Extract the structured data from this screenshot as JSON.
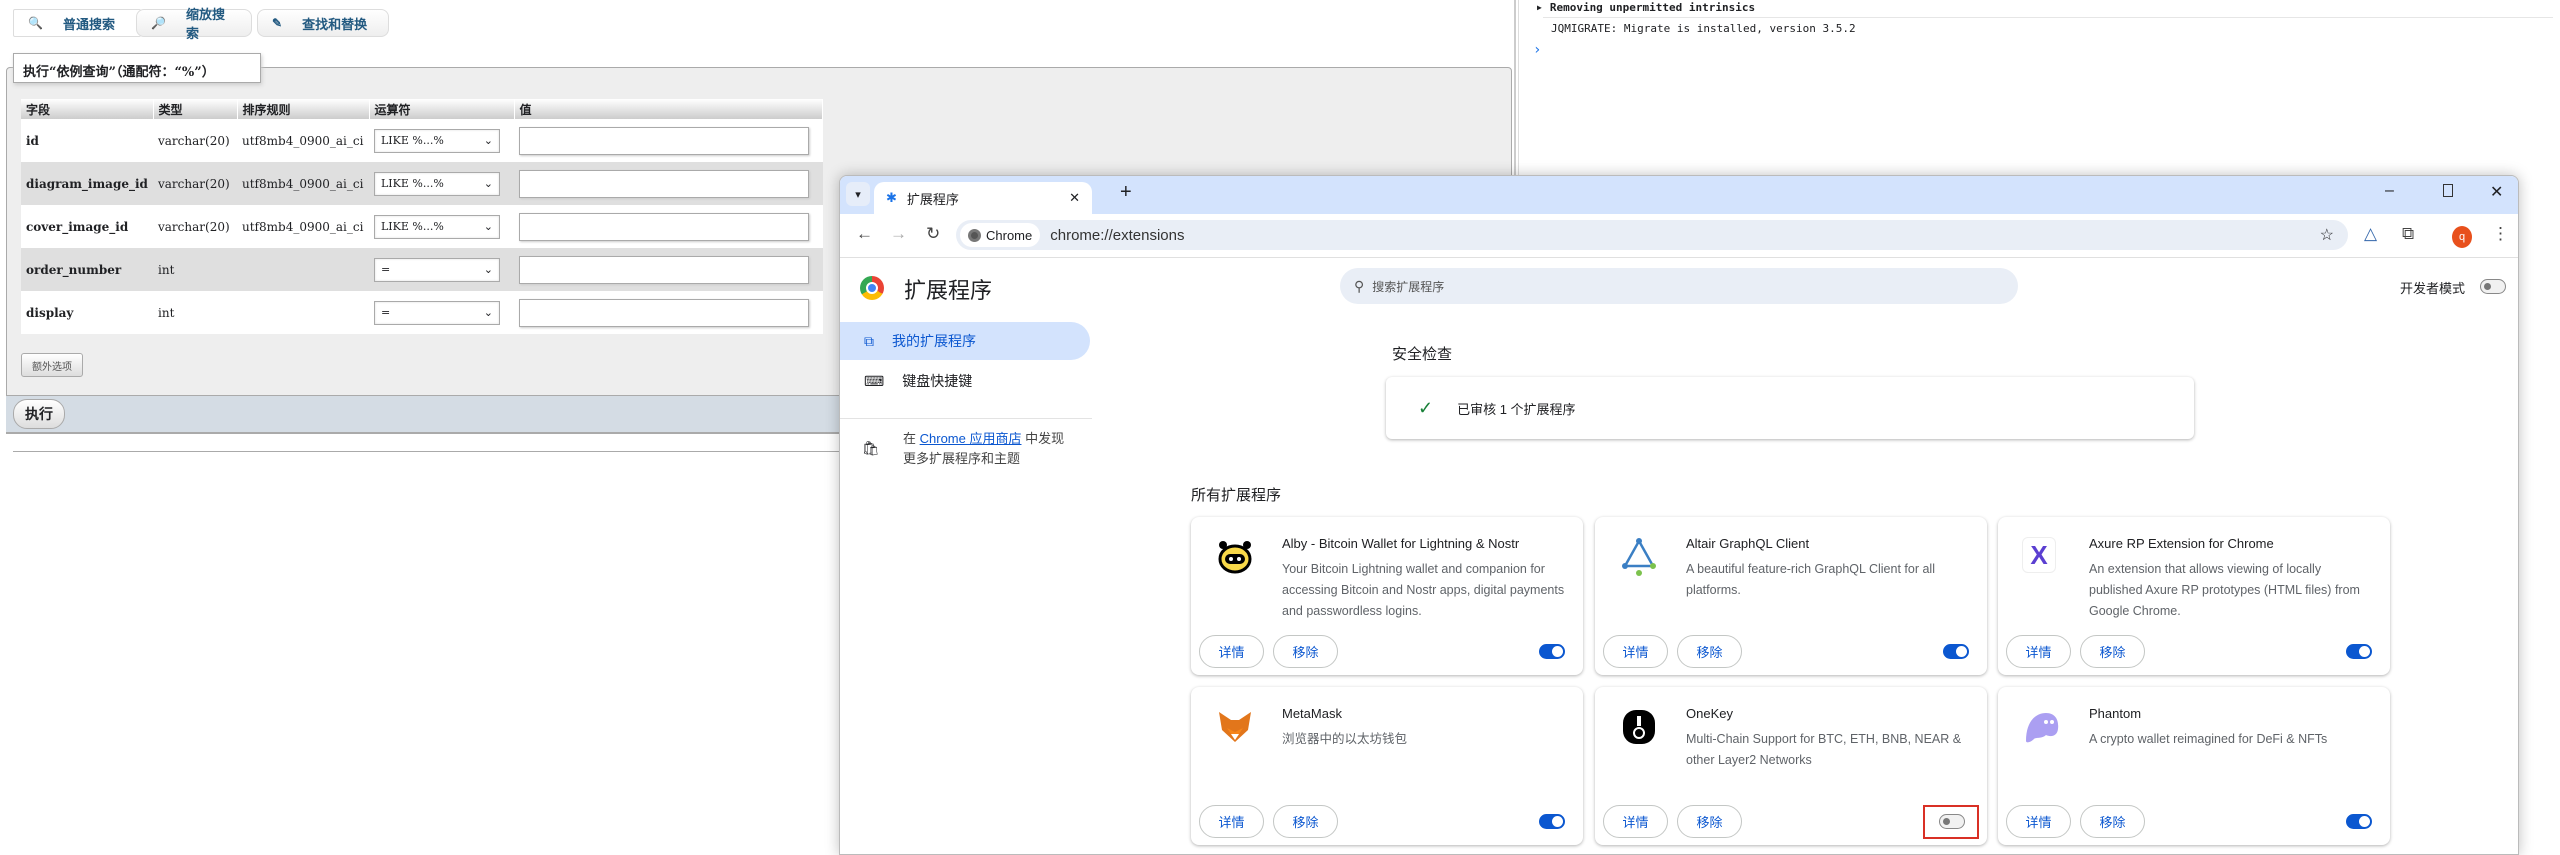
{
  "pma": {
    "tabs": [
      {
        "label": "普通搜索",
        "icon": "magnifier-icon"
      },
      {
        "label": "缩放搜索",
        "icon": "zoom-search-icon"
      },
      {
        "label": "查找和替换",
        "icon": "find-replace-icon"
      }
    ],
    "legend": "执行“依例查询”（通配符：“%”）",
    "headers": [
      "字段",
      "类型",
      "排序规则",
      "运算符",
      "值"
    ],
    "rows": [
      {
        "field": "id",
        "type": "varchar(20)",
        "collation": "utf8mb4_0900_ai_ci",
        "op": "LIKE %...%",
        "value": ""
      },
      {
        "field": "diagram_image_id",
        "type": "varchar(20)",
        "collation": "utf8mb4_0900_ai_ci",
        "op": "LIKE %...%",
        "value": ""
      },
      {
        "field": "cover_image_id",
        "type": "varchar(20)",
        "collation": "utf8mb4_0900_ai_ci",
        "op": "LIKE %...%",
        "value": ""
      },
      {
        "field": "order_number",
        "type": "int",
        "collation": "",
        "op": "=",
        "value": ""
      },
      {
        "field": "display",
        "type": "int",
        "collation": "",
        "op": "=",
        "value": ""
      }
    ],
    "extra_label": "额外选项",
    "exec_label": "执行"
  },
  "console": {
    "lines": [
      "Removing unpermitted intrinsics",
      "JQMIGRATE: Migrate is installed, version 3.5.2"
    ],
    "prompt": "›"
  },
  "chrome": {
    "tab_title": "扩展程序",
    "chip": "Chrome",
    "url": "chrome://extensions",
    "avatar": "q",
    "page_title": "扩展程序",
    "search_placeholder": "搜索扩展程序",
    "dev_mode": "开发者模式",
    "nav": [
      "我的扩展程序",
      "键盘快捷键"
    ],
    "store": {
      "pre": "在 ",
      "link": "Chrome 应用商店",
      "post": " 中发现",
      "line2": "更多扩展程序和主题"
    },
    "safety_title": "安全检查",
    "safety_text": "已审核 1 个扩展程序",
    "all_title": "所有扩展程序",
    "details": "详情",
    "remove": "移除",
    "extensions": [
      {
        "name": "Alby - Bitcoin Wallet for Lightning & Nostr",
        "desc": "Your Bitcoin Lightning wallet and companion for accessing Bitcoin and Nostr apps, digital payments and passwordless logins.",
        "enabled": true
      },
      {
        "name": "Altair GraphQL Client",
        "desc": "A beautiful feature-rich GraphQL Client for all platforms.",
        "enabled": true
      },
      {
        "name": "Axure RP Extension for Chrome",
        "desc": "An extension that allows viewing of locally published Axure RP prototypes (HTML files) from Google Chrome.",
        "enabled": true
      },
      {
        "name": "MetaMask",
        "desc": "浏览器中的以太坊钱包",
        "enabled": true
      },
      {
        "name": "OneKey",
        "desc": "Multi-Chain Support for BTC, ETH, BNB, NEAR & other Layer2 Networks",
        "enabled": false
      },
      {
        "name": "Phantom",
        "desc": "A crypto wallet reimagined for DeFi & NFTs",
        "enabled": true
      }
    ],
    "colors": {
      "accent": "#0b57d0",
      "tabbar": "#d3e3fd",
      "highlight": "#d93025"
    }
  }
}
